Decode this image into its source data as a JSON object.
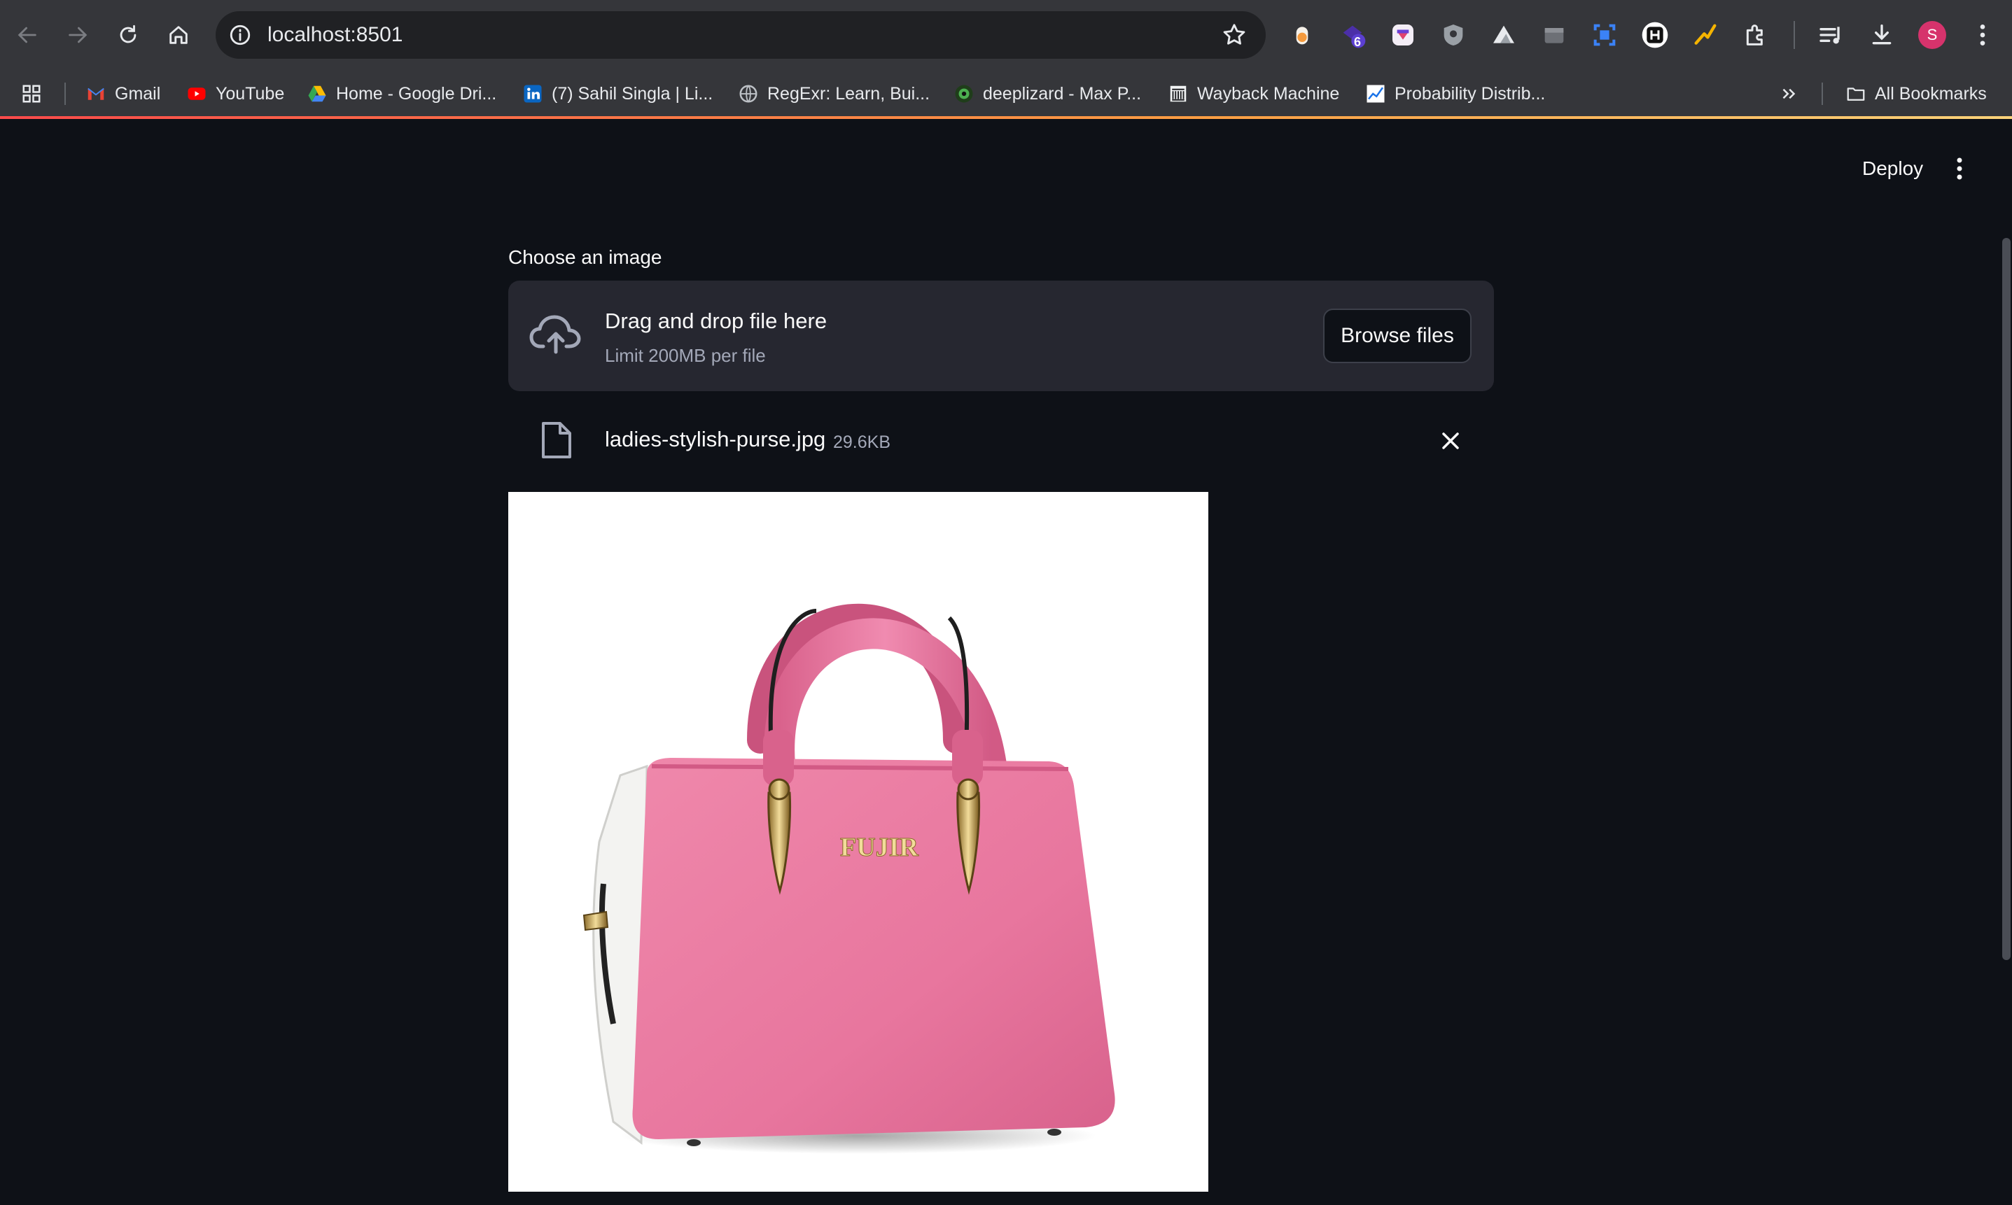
{
  "browser": {
    "url": "localhost:8501",
    "bookmarks": [
      {
        "label": "Gmail"
      },
      {
        "label": "YouTube"
      },
      {
        "label": "Home - Google Dri..."
      },
      {
        "label": "(7) Sahil Singla | Li..."
      },
      {
        "label": "RegExr: Learn, Bui..."
      },
      {
        "label": "deeplizard - Max P..."
      },
      {
        "label": "Wayback Machine"
      },
      {
        "label": "Probability Distrib..."
      }
    ],
    "all_bookmarks": "All Bookmarks",
    "extension_badge": "6",
    "profile_initial": "S"
  },
  "app": {
    "deploy_label": "Deploy",
    "uploader": {
      "label": "Choose an image",
      "drag_text": "Drag and drop file here",
      "limit_text": "Limit 200MB per file",
      "browse_label": "Browse files"
    },
    "file": {
      "name": "ladies-stylish-purse.jpg",
      "size": "29.6KB"
    },
    "image": {
      "logo_text": "FUJIR"
    }
  },
  "colors": {
    "app_bg": "#0e1117",
    "chrome_bg": "#35363a",
    "dropzone_bg": "#262730",
    "accent": "#ff4b4b",
    "purse_pink": "#e8769e"
  }
}
